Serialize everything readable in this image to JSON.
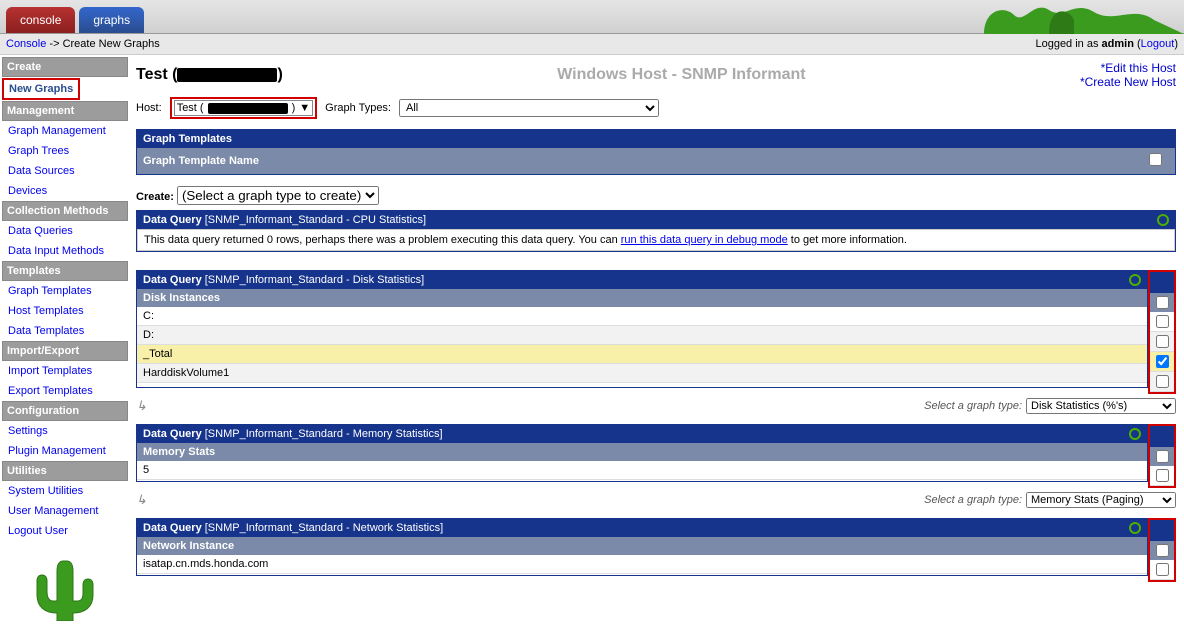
{
  "tabs": {
    "console": "console",
    "graphs": "graphs"
  },
  "breadcrumb": {
    "console": "Console",
    "sep": " -> ",
    "page": "Create New Graphs"
  },
  "login": {
    "prefix": "Logged in as ",
    "user": "admin",
    "logout": "Logout"
  },
  "sidebar": {
    "create": "Create",
    "new_graphs": "New Graphs",
    "management": "Management",
    "graph_management": "Graph Management",
    "graph_trees": "Graph Trees",
    "data_sources": "Data Sources",
    "devices": "Devices",
    "collection_methods": "Collection Methods",
    "data_queries": "Data Queries",
    "data_input_methods": "Data Input Methods",
    "templates": "Templates",
    "graph_templates": "Graph Templates",
    "host_templates": "Host Templates",
    "data_templates": "Data Templates",
    "import_export": "Import/Export",
    "import_templates": "Import Templates",
    "export_templates": "Export Templates",
    "configuration": "Configuration",
    "settings": "Settings",
    "plugin_management": "Plugin Management",
    "utilities": "Utilities",
    "system_utilities": "System Utilities",
    "user_management": "User Management",
    "logout_user": "Logout User"
  },
  "header": {
    "title_prefix": "Test (",
    "title_suffix": ")",
    "subtitle": "Windows Host - SNMP Informant",
    "edit_host": "*Edit this Host",
    "create_host": "*Create New Host"
  },
  "filters": {
    "host_label": "Host:",
    "host_value": "Test (",
    "host_suffix": ")",
    "graph_types_label": "Graph Types:",
    "graph_types_value": "All"
  },
  "gt_section": {
    "title": "Graph Templates",
    "subtitle": "Graph Template Name",
    "create_label": "Create:",
    "create_value": "(Select a graph type to create)"
  },
  "dq_cpu": {
    "title_prefix": "Data Query ",
    "title_bracket": "[SNMP_Informant_Standard - CPU Statistics]",
    "warning_prefix": "This data query returned 0 rows, perhaps there was a problem executing this data query. You can ",
    "warning_link": "run this data query in debug mode",
    "warning_suffix": " to get more information."
  },
  "dq_disk": {
    "title_prefix": "Data Query ",
    "title_bracket": "[SNMP_Informant_Standard - Disk Statistics]",
    "subtitle": "Disk Instances",
    "rows": [
      "C:",
      "D:",
      "_Total",
      "HarddiskVolume1"
    ],
    "select_label": "Select a graph type:",
    "select_value": "Disk Statistics (%'s)"
  },
  "dq_mem": {
    "title_prefix": "Data Query ",
    "title_bracket": "[SNMP_Informant_Standard - Memory Statistics]",
    "subtitle": "Memory Stats",
    "rows": [
      "5"
    ],
    "select_label": "Select a graph type:",
    "select_value": "Memory Stats (Paging)"
  },
  "dq_net": {
    "title_prefix": "Data Query ",
    "title_bracket": "[SNMP_Informant_Standard - Network Statistics]",
    "subtitle": "Network Instance",
    "rows": [
      "isatap.cn.mds.honda.com"
    ]
  }
}
